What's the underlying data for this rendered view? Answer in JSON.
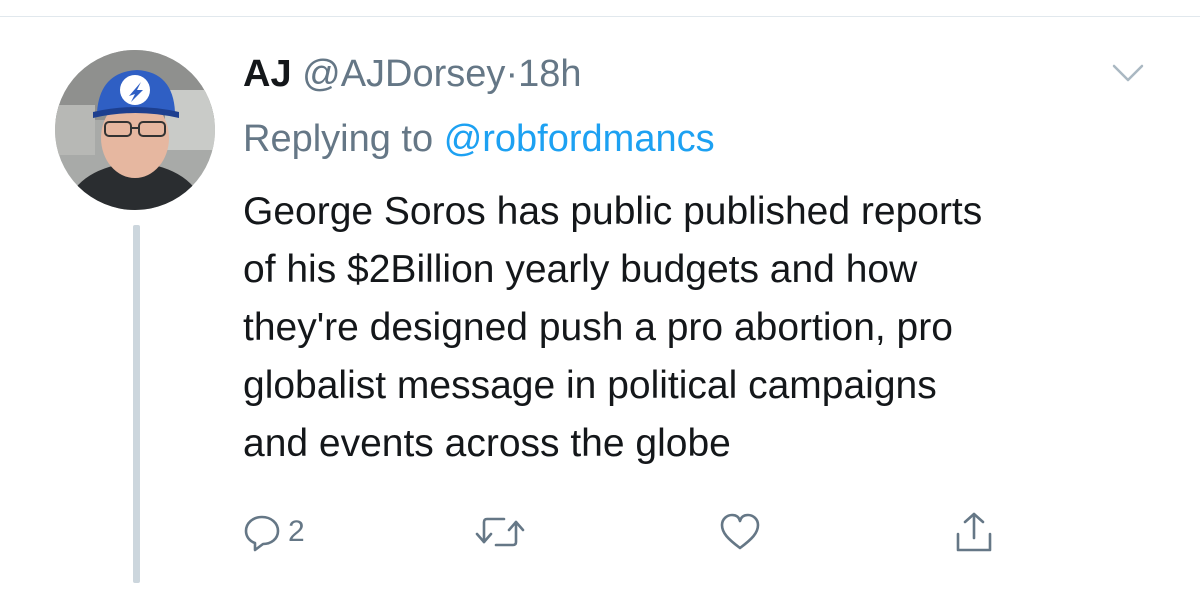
{
  "tweet": {
    "author_name": "AJ",
    "author_handle": "@AJDorsey",
    "separator": "·",
    "timestamp": "18h",
    "replying_prefix": "Replying to",
    "replying_handle": "@robfordmancs",
    "text_lines": [
      "George Soros has public published reports",
      "of his $2Billion yearly budgets and how",
      "they're designed push a pro abortion, pro",
      "globalist message in political campaigns",
      "and events across the globe"
    ]
  },
  "actions": {
    "reply_count": "2",
    "reply_icon": "reply-icon",
    "retweet_icon": "retweet-icon",
    "like_icon": "heart-icon",
    "share_icon": "share-icon"
  },
  "colors": {
    "link": "#1da1f2",
    "secondary_text": "#657786",
    "primary_text": "#14171a",
    "thread_line": "#ccd6dd",
    "cap": "#2f5fc4"
  }
}
